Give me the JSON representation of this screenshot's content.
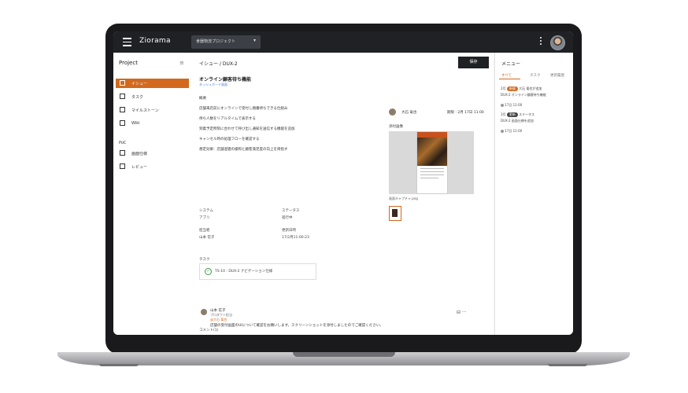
{
  "app": {
    "title": "Ziorama",
    "project_select": "食器物流プロジェクト",
    "project_caret": "▾"
  },
  "sidebar": {
    "title": "Project",
    "collapse_icon": "≡",
    "items": [
      {
        "label": "イシュー",
        "icon": "issue-icon"
      },
      {
        "label": "タスク",
        "icon": "task-icon"
      },
      {
        "label": "マイルストーン",
        "icon": "flag-icon"
      },
      {
        "label": "Wiki",
        "icon": "wiki-icon"
      }
    ],
    "section": "PoC",
    "section_items": [
      {
        "label": "画面仕様",
        "icon": "screen-icon"
      },
      {
        "label": "レビュー",
        "icon": "image-icon"
      }
    ]
  },
  "main": {
    "breadcrumb": "イシュー / DUX-2",
    "action_button": "保存",
    "issue_title": "オンライン顧客待ち機能",
    "issue_subtitle": "ダッシュボード画面",
    "description": [
      "概要",
      "店舗来店前にオンラインで受付し順番待ちできる仕組み",
      "待ち人数をリアルタイムで表示する",
      "到着予定時刻に合わせて呼び出し通知を送信する機能を追加",
      "キャンセル時の処理フローを確認する",
      "想定効果：店舗混雑の緩和と顧客満足度の向上を目指す"
    ],
    "meta": [
      {
        "label": "システム",
        "value": "アプリ"
      },
      {
        "label": "ステータス",
        "value": "進行中"
      },
      {
        "label": "担当者",
        "value": "山本 花子"
      },
      {
        "label": "更新日時",
        "value": "17/2月11:00:23"
      }
    ],
    "task_label": "タスク",
    "task_item": "TS-10 : DUX-2 ナビゲーション仕様",
    "assignee": "大石 竜也",
    "due": "期限 : 2月 17日 11:00",
    "attachment_label": "添付画像",
    "preview_caption": "画面キャプチャ.png",
    "comments_header": "コメント(1)"
  },
  "panel": {
    "title": "メニュー",
    "tabs": [
      "すべて",
      "タスク",
      "更新履歴"
    ],
    "feed": [
      {
        "prefix": "2月",
        "pill": "新規",
        "text": "大石 竜也が追加"
      },
      {
        "text": "DUX-2 オンライン顧客待ち機能"
      },
      {
        "text": "17日 11:00"
      },
      {
        "prefix": "3月",
        "pill": "更新",
        "text": "ステータス"
      },
      {
        "text": "DUX-2 画面仕様を追加"
      },
      {
        "text": "17日 11:00"
      }
    ]
  },
  "comment": {
    "name": "山本 花子",
    "role": "プロダクト担当",
    "mention": "@大石 竜也",
    "text": "店舗の受付画面のUIについて確認をお願いします。スクリーンショットを添付しましたのでご確認ください。",
    "actions": "⊟ ···"
  }
}
